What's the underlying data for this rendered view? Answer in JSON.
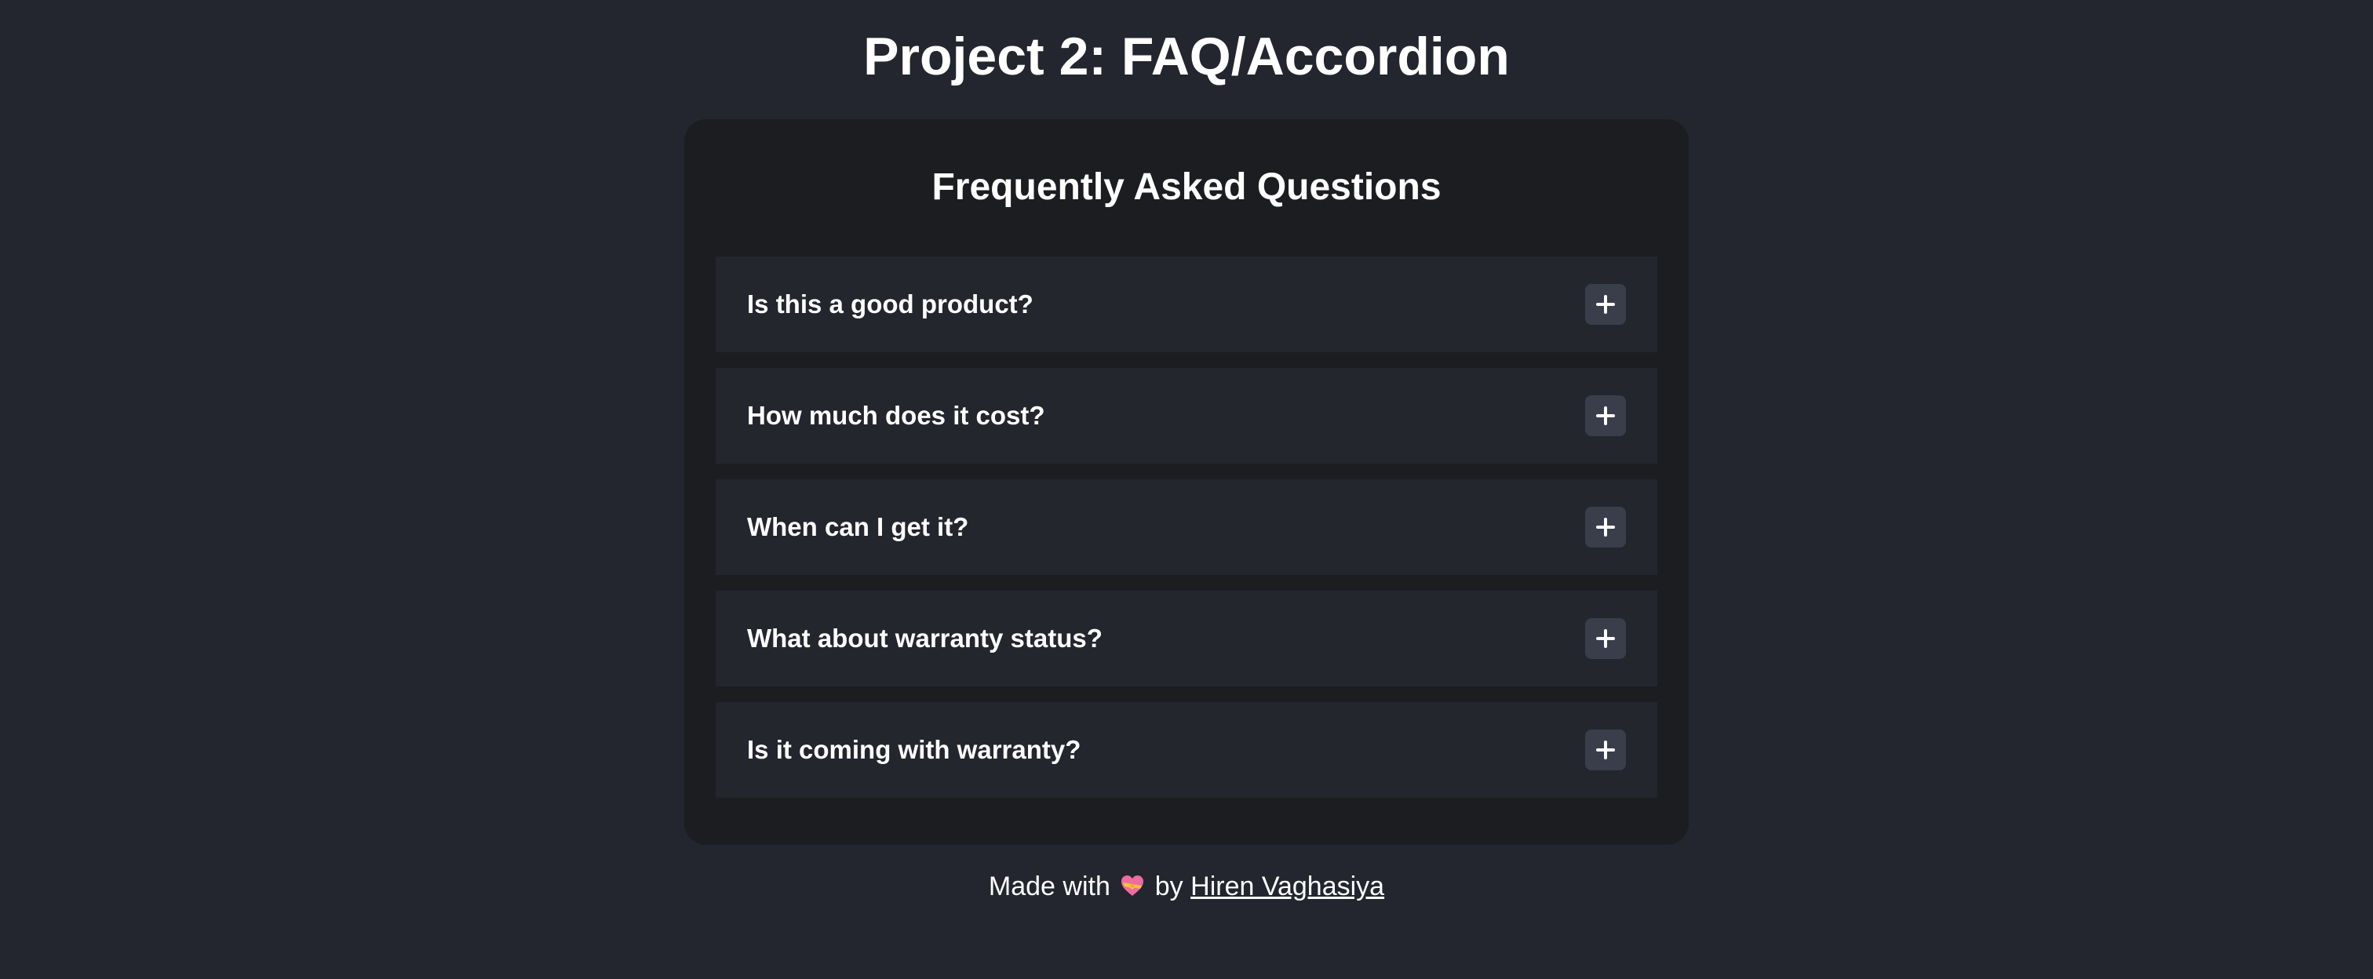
{
  "page": {
    "title": "Project 2: FAQ/Accordion"
  },
  "faq": {
    "title": "Frequently Asked Questions",
    "items": [
      {
        "question": "Is this a good product?",
        "toggle_icon": "plus-icon"
      },
      {
        "question": "How much does it cost?",
        "toggle_icon": "plus-icon"
      },
      {
        "question": "When can I get it?",
        "toggle_icon": "plus-icon"
      },
      {
        "question": "What about warranty status?",
        "toggle_icon": "plus-icon"
      },
      {
        "question": "Is it coming with warranty?",
        "toggle_icon": "plus-icon"
      }
    ]
  },
  "footer": {
    "prefix": "Made with",
    "icon": "heart-with-ribbon-icon",
    "by": "by",
    "author": "Hiren Vaghasiya"
  },
  "colors": {
    "background": "#23262e",
    "card": "#1c1d21",
    "item": "#24262e",
    "toggle_button": "#3a3e4b",
    "text": "#ffffff"
  }
}
